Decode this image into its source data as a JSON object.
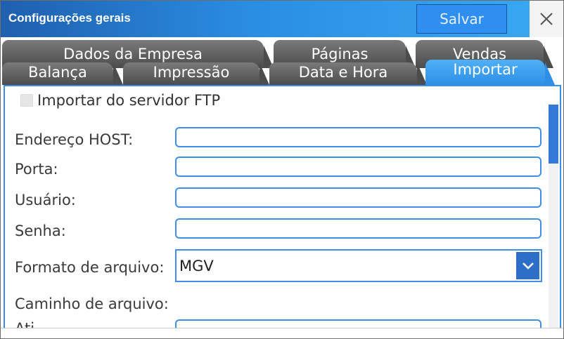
{
  "window": {
    "title": "Configurações gerais",
    "save_label": "Salvar",
    "close_icon": "close-icon"
  },
  "tabs": {
    "row1": [
      {
        "label": "Dados da Empresa"
      },
      {
        "label": "Páginas"
      },
      {
        "label": "Vendas"
      }
    ],
    "row2": [
      {
        "label": "Balança"
      },
      {
        "label": "Impressão"
      },
      {
        "label": "Data e Hora"
      },
      {
        "label": "Importar"
      }
    ],
    "active": "Importar"
  },
  "form": {
    "ftp_checkbox_label": "Importar do servidor FTP",
    "ftp_checked": false,
    "host_label": "Endereço HOST:",
    "host_value": "",
    "port_label": "Porta:",
    "port_value": "",
    "user_label": "Usuário:",
    "user_value": "",
    "password_label": "Senha:",
    "password_value": "",
    "format_label": "Formato de arquivo:",
    "format_value": "MGV",
    "path_label": "Caminho de arquivo:",
    "next_label_partial": "Ati"
  },
  "colors": {
    "accent": "#3f8fe6",
    "titlebar": "#2a8ee3",
    "active_tab": "#2d8fe6",
    "inactive_tab": "#4c4c4c"
  }
}
